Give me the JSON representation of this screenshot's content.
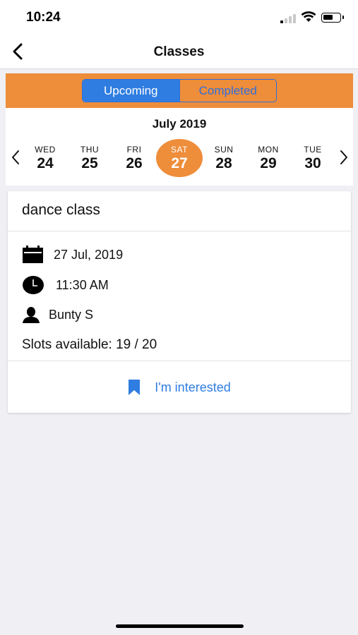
{
  "status": {
    "time": "10:24"
  },
  "nav": {
    "title": "Classes"
  },
  "segments": {
    "upcoming": "Upcoming",
    "completed": "Completed",
    "active": "Upcoming"
  },
  "calendar": {
    "month": "July 2019",
    "days": [
      {
        "dow": "WED",
        "num": "24"
      },
      {
        "dow": "THU",
        "num": "25"
      },
      {
        "dow": "FRI",
        "num": "26"
      },
      {
        "dow": "SAT",
        "num": "27"
      },
      {
        "dow": "SUN",
        "num": "28"
      },
      {
        "dow": "MON",
        "num": "29"
      },
      {
        "dow": "TUE",
        "num": "30"
      }
    ],
    "selected_day": "27"
  },
  "class_card": {
    "name": "dance class",
    "date": "27 Jul, 2019",
    "time": "11:30 AM",
    "instructor": "Bunty S",
    "slots": "Slots available: 19 / 20",
    "action_label": "I'm interested"
  },
  "colors": {
    "accent_orange": "#ee8d3a",
    "accent_blue": "#2f7de1",
    "background": "#efeff4"
  },
  "icons": {
    "back": "chevron-left-icon",
    "calendar": "calendar-icon",
    "clock": "clock-icon",
    "person": "person-icon",
    "bookmark": "bookmark-icon"
  }
}
